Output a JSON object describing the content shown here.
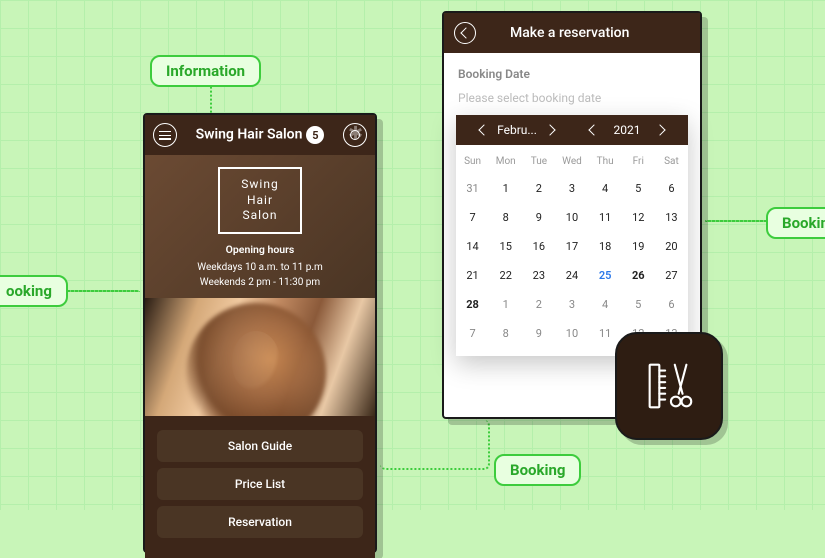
{
  "tags": {
    "info": "Information",
    "booking_left": "ooking",
    "booking_bottom": "Booking",
    "booking_right": "Bookin"
  },
  "phone1": {
    "title": "Swing Hair Salon",
    "badge": "5",
    "logo_line1": "Swing",
    "logo_line2": "Hair",
    "logo_line3": "Salon",
    "hours_heading": "Opening hours",
    "hours_line1": "Weekdays 10 a.m. to 11 p.m",
    "hours_line2": "Weekends 2 pm - 11:30 pm",
    "buttons": [
      "Salon Guide",
      "Price List",
      "Reservation"
    ]
  },
  "phone2": {
    "title": "Make a reservation",
    "label": "Booking Date",
    "placeholder": "Please select booking date",
    "month": "Febru...",
    "year": "2021",
    "dow": [
      "Sun",
      "Mon",
      "Tue",
      "Wed",
      "Thu",
      "Fri",
      "Sat"
    ],
    "weeks": [
      [
        {
          "d": 31,
          "o": true
        },
        {
          "d": 1
        },
        {
          "d": 2
        },
        {
          "d": 3
        },
        {
          "d": 4
        },
        {
          "d": 5
        },
        {
          "d": 6
        }
      ],
      [
        {
          "d": 7
        },
        {
          "d": 8
        },
        {
          "d": 9
        },
        {
          "d": 10
        },
        {
          "d": 11
        },
        {
          "d": 12
        },
        {
          "d": 13
        }
      ],
      [
        {
          "d": 14
        },
        {
          "d": 15
        },
        {
          "d": 16
        },
        {
          "d": 17
        },
        {
          "d": 18
        },
        {
          "d": 19
        },
        {
          "d": 20
        }
      ],
      [
        {
          "d": 21
        },
        {
          "d": 22
        },
        {
          "d": 23
        },
        {
          "d": 24
        },
        {
          "d": 25,
          "t": true
        },
        {
          "d": 26,
          "b": true
        },
        {
          "d": 27
        }
      ],
      [
        {
          "d": 28,
          "b": true
        },
        {
          "d": 1,
          "o": true
        },
        {
          "d": 2,
          "o": true
        },
        {
          "d": 3,
          "o": true
        },
        {
          "d": 4,
          "o": true
        },
        {
          "d": 5,
          "o": true
        },
        {
          "d": 6,
          "o": true
        }
      ],
      [
        {
          "d": 7,
          "o": true
        },
        {
          "d": 8,
          "o": true
        },
        {
          "d": 9,
          "o": true
        },
        {
          "d": 10,
          "o": true
        },
        {
          "d": 11,
          "o": true
        },
        {
          "d": 12,
          "o": true
        },
        {
          "d": 13,
          "o": true
        }
      ]
    ]
  }
}
